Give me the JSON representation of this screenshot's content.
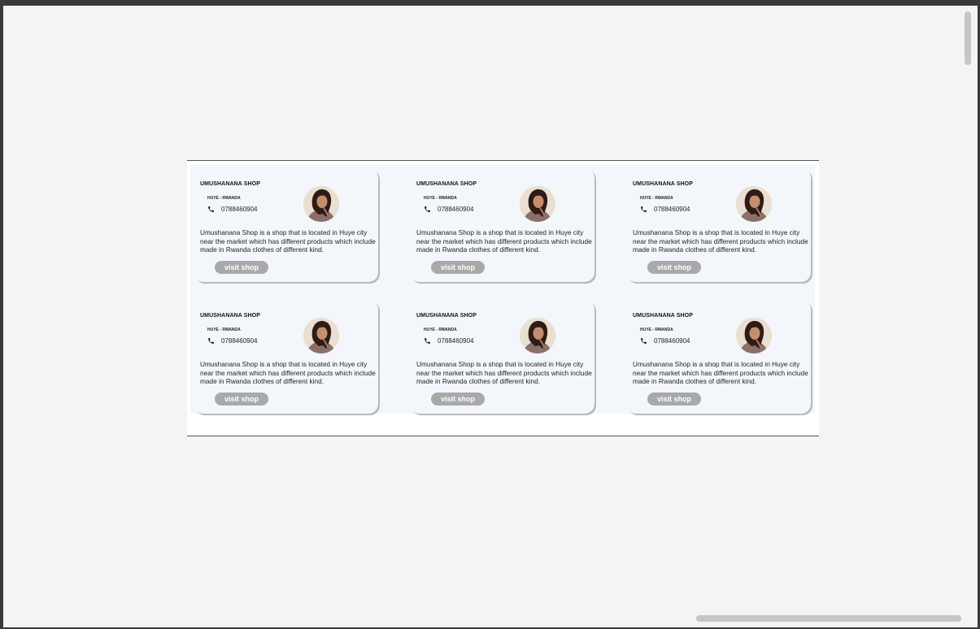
{
  "shops": [
    {
      "title": "UMUSHANANA SHOP",
      "location": "HUYE - RWANDA",
      "phone": "0788460904",
      "description": "Umushanana Shop is a shop that is located in Huye city near the market which has different products which include made in Rwanda clothes of different kind.",
      "button_label": "visit shop",
      "phone_icon": "phone-icon",
      "avatar": "avatar"
    },
    {
      "title": "UMUSHANANA SHOP",
      "location": "HUYE - RWANDA",
      "phone": "0788460904",
      "description": "Umushanana Shop is a shop that is located in Huye city near the market which has different products which include made in Rwanda clothes of different kind.",
      "button_label": "visit shop",
      "phone_icon": "phone-icon",
      "avatar": "avatar"
    },
    {
      "title": "UMUSHANANA SHOP",
      "location": "HUYE - RWANDA",
      "phone": "0788460904",
      "description": "Umushanana Shop is a shop that is located in Huye city near the market which has different products which include made in Rwanda clothes of different kind.",
      "button_label": "visit shop",
      "phone_icon": "phone-icon",
      "avatar": "avatar"
    },
    {
      "title": "UMUSHANANA SHOP",
      "location": "HUYE - RWANDA",
      "phone": "0788460904",
      "description": "Umushanana Shop is a shop that is located in Huye city near the market which has different products which include made in Rwanda clothes of different kind.",
      "button_label": "visit shop",
      "phone_icon": "phone-icon",
      "avatar": "avatar"
    },
    {
      "title": "UMUSHANANA SHOP",
      "location": "HUYE - RWANDA",
      "phone": "0788460904",
      "description": "Umushanana Shop is a shop that is located in Huye city near the market which has different products which include made in Rwanda clothes of different kind.",
      "button_label": "visit shop",
      "phone_icon": "phone-icon",
      "avatar": "avatar"
    },
    {
      "title": "UMUSHANANA SHOP",
      "location": "HUYE - RWANDA",
      "phone": "0788460904",
      "description": "Umushanana Shop is a shop that is located in Huye city near the market which has different products which include made in Rwanda clothes of different kind.",
      "button_label": "visit shop",
      "phone_icon": "phone-icon",
      "avatar": "avatar"
    }
  ],
  "colors": {
    "page_background": "#f4f4f4",
    "card_background": "#f3f7fb",
    "button_background": "#a9a9a9",
    "button_text": "#ffffff"
  }
}
